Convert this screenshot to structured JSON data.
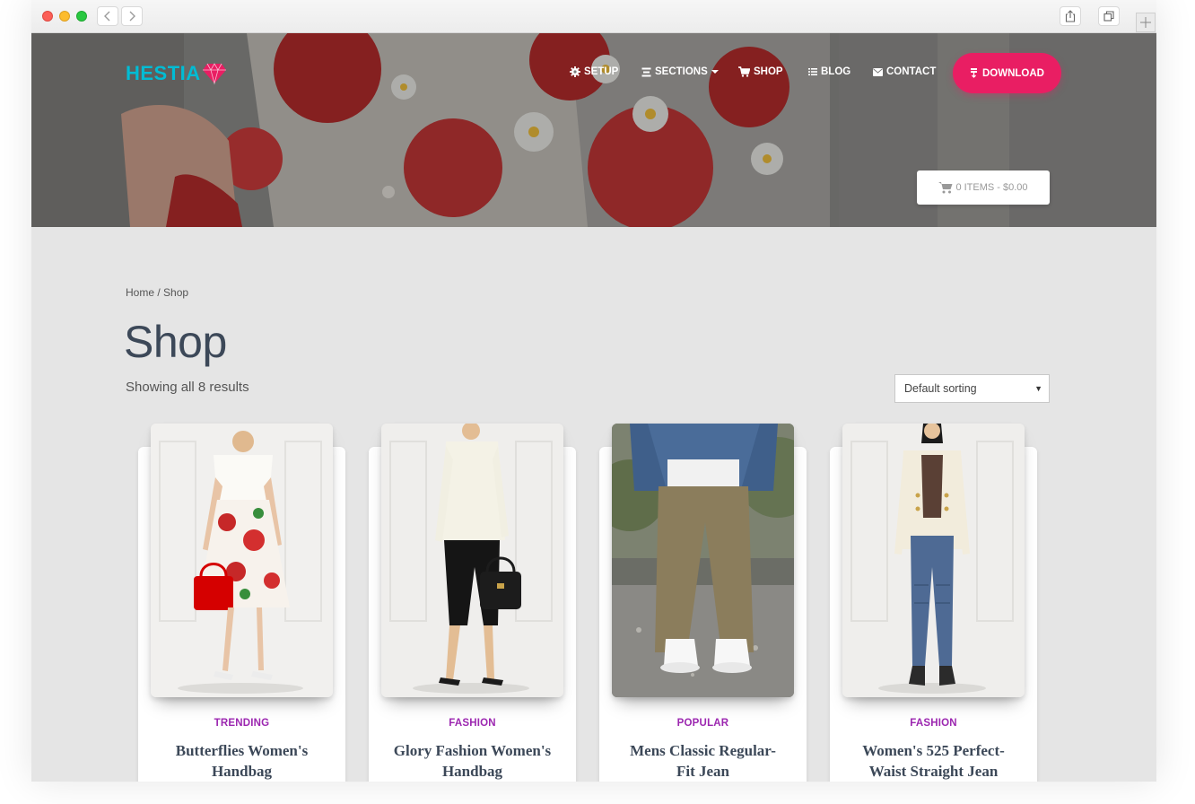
{
  "brand": {
    "name": "HESTIA",
    "accent": "#00bcd4",
    "logo_icon": "diamond-icon"
  },
  "nav": {
    "items": [
      {
        "label": "SETUP",
        "icon": "gear-icon"
      },
      {
        "label": "SECTIONS",
        "icon": "sections-icon",
        "has_dropdown": true
      },
      {
        "label": "SHOP",
        "icon": "cart-icon"
      },
      {
        "label": "BLOG",
        "icon": "list-icon"
      },
      {
        "label": "CONTACT",
        "icon": "envelope-icon"
      }
    ],
    "download_label": "DOWNLOAD",
    "download_color": "#e91e63"
  },
  "cart": {
    "label": "0 ITEMS - $0.00"
  },
  "breadcrumb": {
    "home": "Home",
    "separator": " / ",
    "current": "Shop"
  },
  "page": {
    "title": "Shop",
    "result_count": "Showing all 8 results"
  },
  "sorting": {
    "selected": "Default sorting"
  },
  "products": [
    {
      "category": "TRENDING",
      "title_line1": "Butterflies Women's",
      "title_line2": "Handbag"
    },
    {
      "category": "FASHION",
      "title_line1": "Glory Fashion Women's",
      "title_line2": "Handbag"
    },
    {
      "category": "POPULAR",
      "title_line1": "Mens Classic Regular-",
      "title_line2": "Fit Jean"
    },
    {
      "category": "FASHION",
      "title_line1": "Women's 525 Perfect-",
      "title_line2": "Waist Straight Jean"
    }
  ],
  "colors": {
    "category_text": "#9c27b0",
    "title_text": "#3c4858",
    "page_bg": "#e5e5e5"
  }
}
